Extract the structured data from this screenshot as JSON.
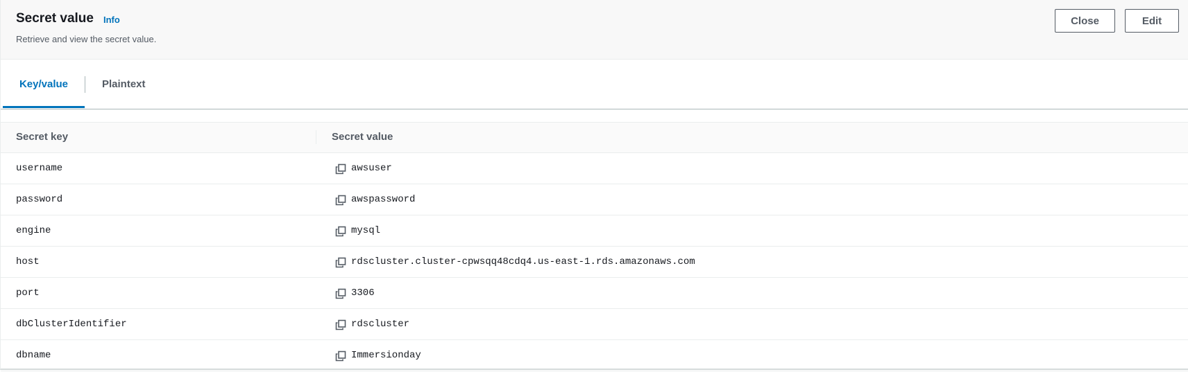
{
  "header": {
    "title": "Secret value",
    "info_label": "Info",
    "description": "Retrieve and view the secret value.",
    "close_label": "Close",
    "edit_label": "Edit"
  },
  "tabs": [
    {
      "label": "Key/value",
      "active": true
    },
    {
      "label": "Plaintext",
      "active": false
    }
  ],
  "table": {
    "columns": [
      "Secret key",
      "Secret value"
    ],
    "rows": [
      {
        "key": "username",
        "value": "awsuser"
      },
      {
        "key": "password",
        "value": "awspassword"
      },
      {
        "key": "engine",
        "value": "mysql"
      },
      {
        "key": "host",
        "value": "rdscluster.cluster-cpwsqq48cdq4.us-east-1.rds.amazonaws.com"
      },
      {
        "key": "port",
        "value": "3306"
      },
      {
        "key": "dbClusterIdentifier",
        "value": "rdscluster"
      },
      {
        "key": "dbname",
        "value": "Immersionday"
      }
    ]
  },
  "icons": {
    "copy": "copy-icon"
  },
  "colors": {
    "accent": "#0073bb",
    "text": "#16191f",
    "muted": "#545b64"
  }
}
